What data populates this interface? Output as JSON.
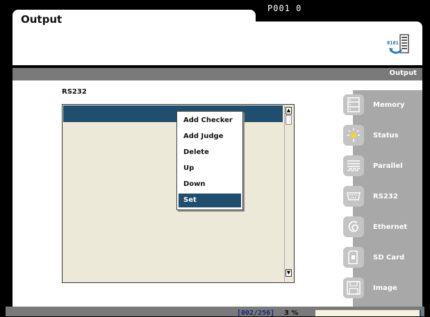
{
  "header": {
    "title": "Output",
    "program_id": "P001 0",
    "icon": "data-transfer-icon"
  },
  "section_bar": {
    "label": "Output"
  },
  "main": {
    "list_label": "RS232",
    "context_menu": {
      "items": [
        "Add Checker",
        "Add Judge",
        "Delete",
        "Up",
        "Down",
        "Set"
      ],
      "selected": "Set"
    }
  },
  "side_nav": {
    "items": [
      {
        "label": "Memory",
        "icon": "memory-icon"
      },
      {
        "label": "Status",
        "icon": "status-light-icon"
      },
      {
        "label": "Parallel",
        "icon": "parallel-port-icon"
      },
      {
        "label": "RS232",
        "icon": "serial-port-icon"
      },
      {
        "label": "Ethernet",
        "icon": "ethernet-icon"
      },
      {
        "label": "SD Card",
        "icon": "sd-card-icon"
      },
      {
        "label": "Image",
        "icon": "save-image-icon"
      }
    ]
  },
  "status_bar": {
    "count": "[002/256]",
    "percent": "3 %"
  },
  "colors": {
    "accent": "#1f4e6e",
    "list_background": "#ece9d8",
    "bar_gray": "#7a7a7a",
    "nav_gray": "#a8a8a8"
  }
}
